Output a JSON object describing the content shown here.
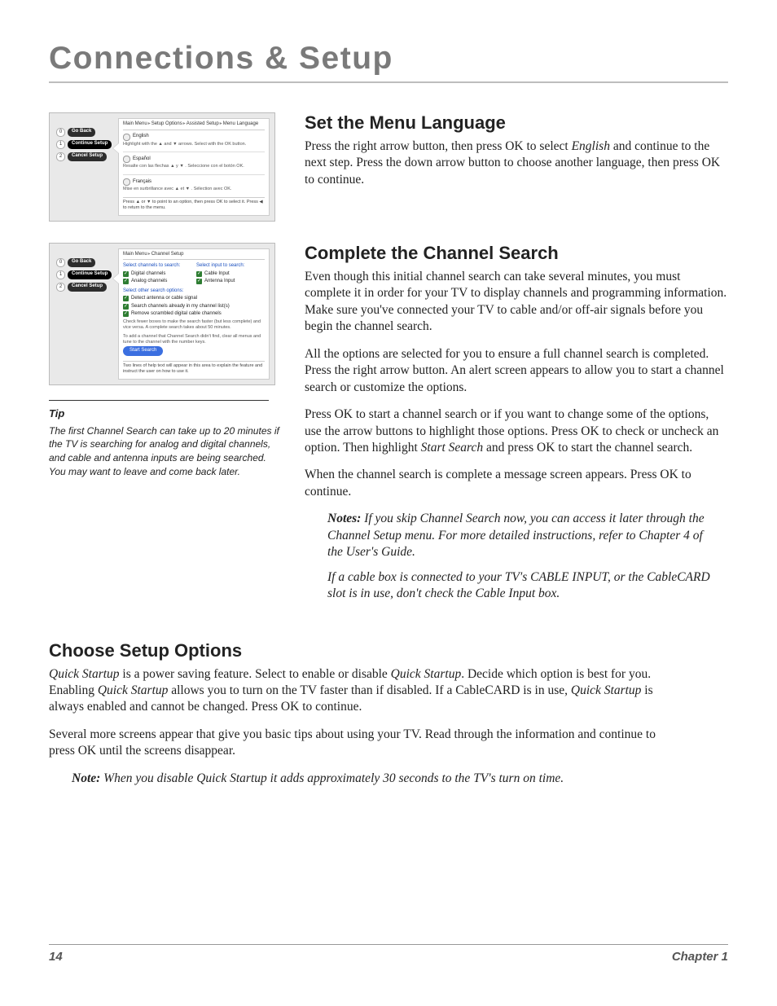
{
  "page_title": "Connections & Setup",
  "sections": {
    "menu_lang": {
      "heading": "Set the Menu Language",
      "p1_pre": "Press the right arrow button, then press OK to select ",
      "p1_em": "English",
      "p1_post": " and continue to the next step. Press the down arrow button to choose another language, then press OK to continue."
    },
    "channel_search": {
      "heading": "Complete the Channel Search",
      "p1": "Even though this initial channel search can take several minutes, you must complete it in order for your TV to display channels and programming information. Make sure you've connected your TV to cable and/or off-air signals before you begin the channel search.",
      "p2": "All the options are selected for you to ensure a full channel search is completed. Press the right arrow button. An alert screen appears to allow you to start a channel search or customize the options.",
      "p3_pre": "Press OK to start a channel search or if you want to change some of the options, use the arrow buttons to highlight those options. Press OK to check or uncheck an option. Then highlight ",
      "p3_em": "Start Search",
      "p3_post": " and press OK to start the channel search.",
      "p4": "When the channel search is complete a message screen appears. Press OK to continue.",
      "note1_label": "Notes:",
      "note1_body": "  If you skip Channel Search now, you can access it later through the Channel Setup menu. For more detailed instructions, refer to Chapter 4 of the User's Guide.",
      "note2": "If a cable box is connected to your TV's CABLE INPUT, or the CableCARD slot is in use, don't check the Cable Input box."
    },
    "setup_options": {
      "heading": "Choose Setup Options",
      "p1_a": "Quick Startup",
      "p1_b": " is a power saving feature. Select to enable or disable ",
      "p1_c": "Quick Startup",
      "p1_d": ". Decide which option is best for you. Enabling ",
      "p1_e": "Quick Startup",
      "p1_f": " allows you to turn on the TV faster than if disabled. If a CableCARD is in use, ",
      "p1_g": "Quick Startup",
      "p1_h": " is always enabled and cannot be changed. Press OK to continue.",
      "p2": "Several more screens appear that give you basic tips about using your TV. Read through the information and continue to press OK until the screens disappear.",
      "note_label": "Note:",
      "note_body": " When you disable Quick Startup it adds approximately 30 seconds to the TV's turn on time."
    }
  },
  "tip": {
    "heading": "Tip",
    "body": "The first Channel Search can take up to 20 minutes if the TV is searching for analog and digital channels, and cable and antenna inputs are being searched. You may want to leave and come back later."
  },
  "footer": {
    "page": "14",
    "chapter": "Chapter 1"
  },
  "tv1": {
    "nav": {
      "n0": "0",
      "l0": "Go Back",
      "n1": "1",
      "l1": "Continue Setup",
      "n2": "2",
      "l2": "Cancel Setup"
    },
    "crumb": {
      "a": "Main Menu",
      "b": "Setup Options",
      "c": "Assisted Setup",
      "d": "Menu Language"
    },
    "english": {
      "label": "English",
      "hint": "Highlight with the ▲ and ▼ arrows. Select with the OK button."
    },
    "espanol": {
      "label": "Español",
      "hint": "Resalte con las flechas ▲ y ▼ . Seleccione con el botón OK."
    },
    "francais": {
      "label": "Français",
      "hint": "Mise en surbrillance avec ▲ et ▼ . Sélection avec OK."
    },
    "foot": "Press ▲ or ▼ to point to an option, then press OK to select it. Press ◀ to return to the menu."
  },
  "tv2": {
    "nav": {
      "n0": "0",
      "l0": "Go Back",
      "n1": "1",
      "l1": "Continue Setup",
      "n2": "2",
      "l2": "Cancel Setup"
    },
    "crumb": {
      "a": "Main Menu",
      "b": "Channel Setup"
    },
    "head_channels": "Select channels to search:",
    "head_inputs": "Select input to search:",
    "cb_digital": "Digital channels",
    "cb_analog": "Analog channels",
    "cb_cable": "Cable Input",
    "cb_antenna": "Antenna Input",
    "head_other": "Select other search options:",
    "cb_detect": "Detect antenna or cable signal",
    "cb_already": "Search channels already in my channel list(s)",
    "cb_remove": "Remove scrambled digital cable channels",
    "note_fewer": "Check fewer boxes to make the search faster (but less complete) and vice versa. A complete search takes about 50 minutes.",
    "note_add": "To add a channel that Channel Search didn't find, clear all menus and tune to the channel with the number keys.",
    "start": "Start Search",
    "foot": "Two lines of help text will appear in this area to explain the feature and instruct the user on how to use it."
  }
}
